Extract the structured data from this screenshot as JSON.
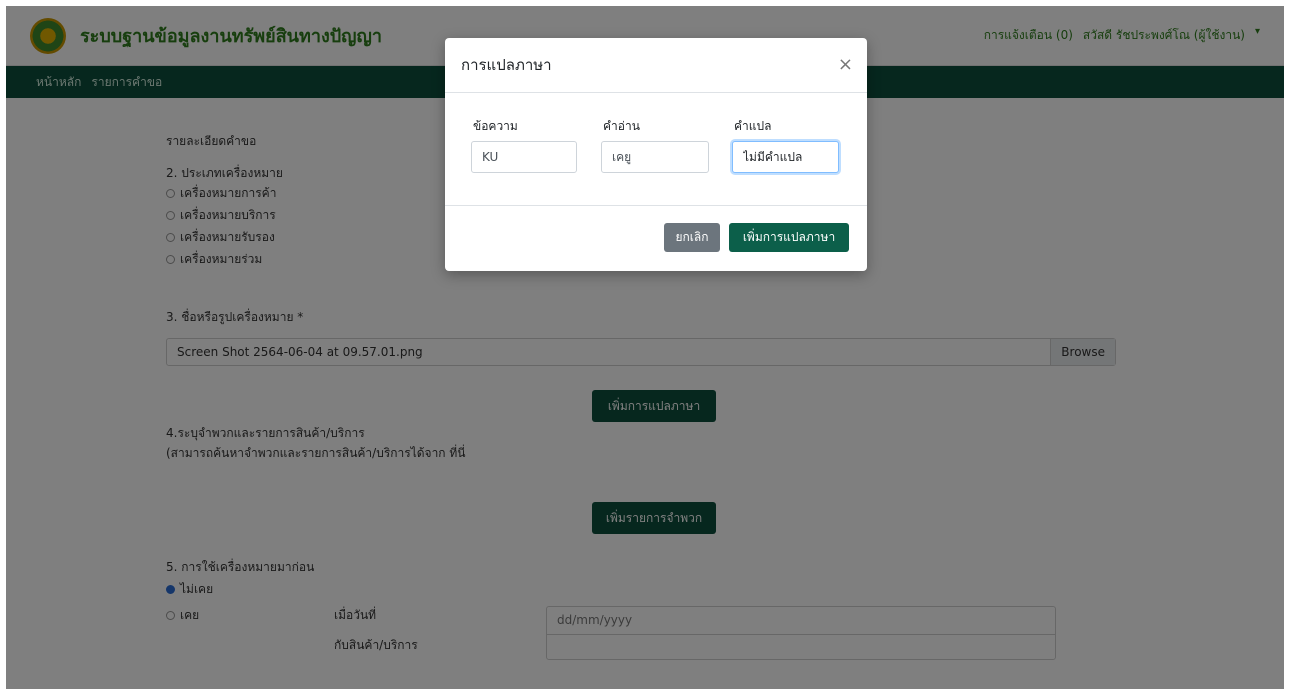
{
  "header": {
    "brand": "ระบบฐานข้อมูลงานทรัพย์สินทางปัญญา",
    "notifications": "การแจ้งเตือน (0)",
    "user": "สวัสดี รัชประพงศ์โณ (ผู้ใช้งาน)",
    "caret_icon": "caret-down-icon"
  },
  "nav": {
    "items": [
      "หน้าหลัก",
      "รายการคำขอ"
    ]
  },
  "form": {
    "section_detail": "รายละเอียดคำขอ",
    "section2_title": "2. ประเภทเครื่องหมาย",
    "mark_types": [
      "เครื่องหมายการค้า",
      "เครื่องหมายบริการ",
      "เครื่องหมายรับรอง",
      "เครื่องหมายร่วม"
    ],
    "section3_title": "3. ชื่อหรือรูปเครื่องหมาย *",
    "file_name": "Screen Shot 2564-06-04 at 09.57.01.png",
    "browse_label": "Browse",
    "add_translation_label": "เพิ่มการแปลภาษา",
    "section4_title": "4.ระบุจำพวกและรายการสินค้า/บริการ",
    "section4_hint": "(สามารถค้นหาจำพวกและรายการสินค้า/บริการได้จาก ที่นี่",
    "add_class_label": "เพิ่มรายการจำพวก",
    "section5_title": "5. การใช้เครื่องหมายมาก่อน",
    "used_options": [
      "ไม่เคย",
      "เคย"
    ],
    "date_label": "เมื่อวันที่",
    "goods_label": "กับสินค้า/บริการ",
    "date_placeholder": "dd/mm/yyyy"
  },
  "modal": {
    "title": "การแปลภาษา",
    "close_icon": "close-icon",
    "close_symbol": "×",
    "text_label": "ข้อความ",
    "text_value": "KU",
    "reading_label": "คำอ่าน",
    "reading_value": "เคยู",
    "translation_label": "คำแปล",
    "translation_value": "ไม่มีคำแปล",
    "cancel_label": "ยกเลิก",
    "add_label": "เพิ่มการแปลภาษา"
  }
}
